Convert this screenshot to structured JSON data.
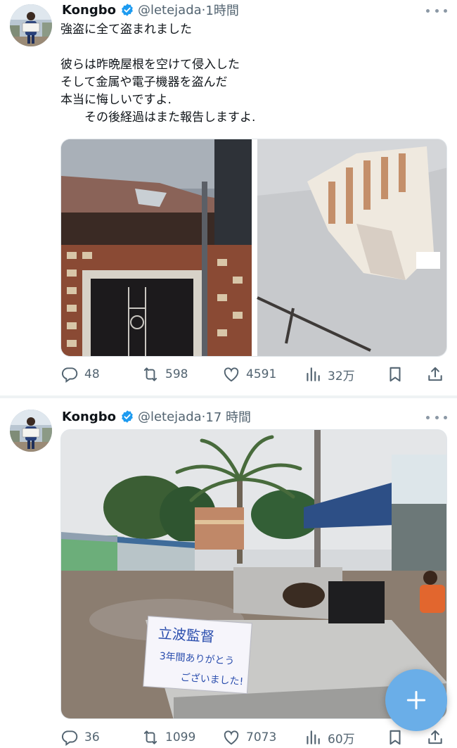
{
  "tweets": [
    {
      "author": {
        "name": "Kongbo",
        "handle": "@letejada",
        "time": "1時間"
      },
      "text_lines": [
        "強盗に全て盗まれました",
        "",
        "彼らは昨晩屋根を空けて侵入した",
        "そして金属や電子機器を盗んだ",
        "本当に悔しいですよ.",
        "　　その後経過はまた報告しますよ."
      ],
      "media": [
        {
          "description_icon": "photo-broken-roof-exterior"
        },
        {
          "description_icon": "photo-hole-in-ceiling"
        }
      ],
      "stats": {
        "replies": "48",
        "retweets": "598",
        "likes": "4591",
        "views": "32万"
      }
    },
    {
      "author": {
        "name": "Kongbo",
        "handle": "@letejada",
        "time": "17 時間"
      },
      "media": [
        {
          "description_icon": "photo-market-street-with-sign",
          "sign_lines": [
            "立波監督",
            "3年間ありがとう",
            "ございました!"
          ]
        }
      ],
      "stats": {
        "replies": "36",
        "retweets": "1099",
        "likes": "7073",
        "views": "60万"
      }
    }
  ],
  "separator_dot": "·",
  "colors": {
    "accent": "#1d9bf0",
    "muted": "#536471",
    "fab": "#6aaee8"
  },
  "icons": [
    "verified-badge-icon",
    "more-icon",
    "reply-icon",
    "retweet-icon",
    "like-icon",
    "views-icon",
    "bookmark-icon",
    "share-icon",
    "compose-icon"
  ]
}
